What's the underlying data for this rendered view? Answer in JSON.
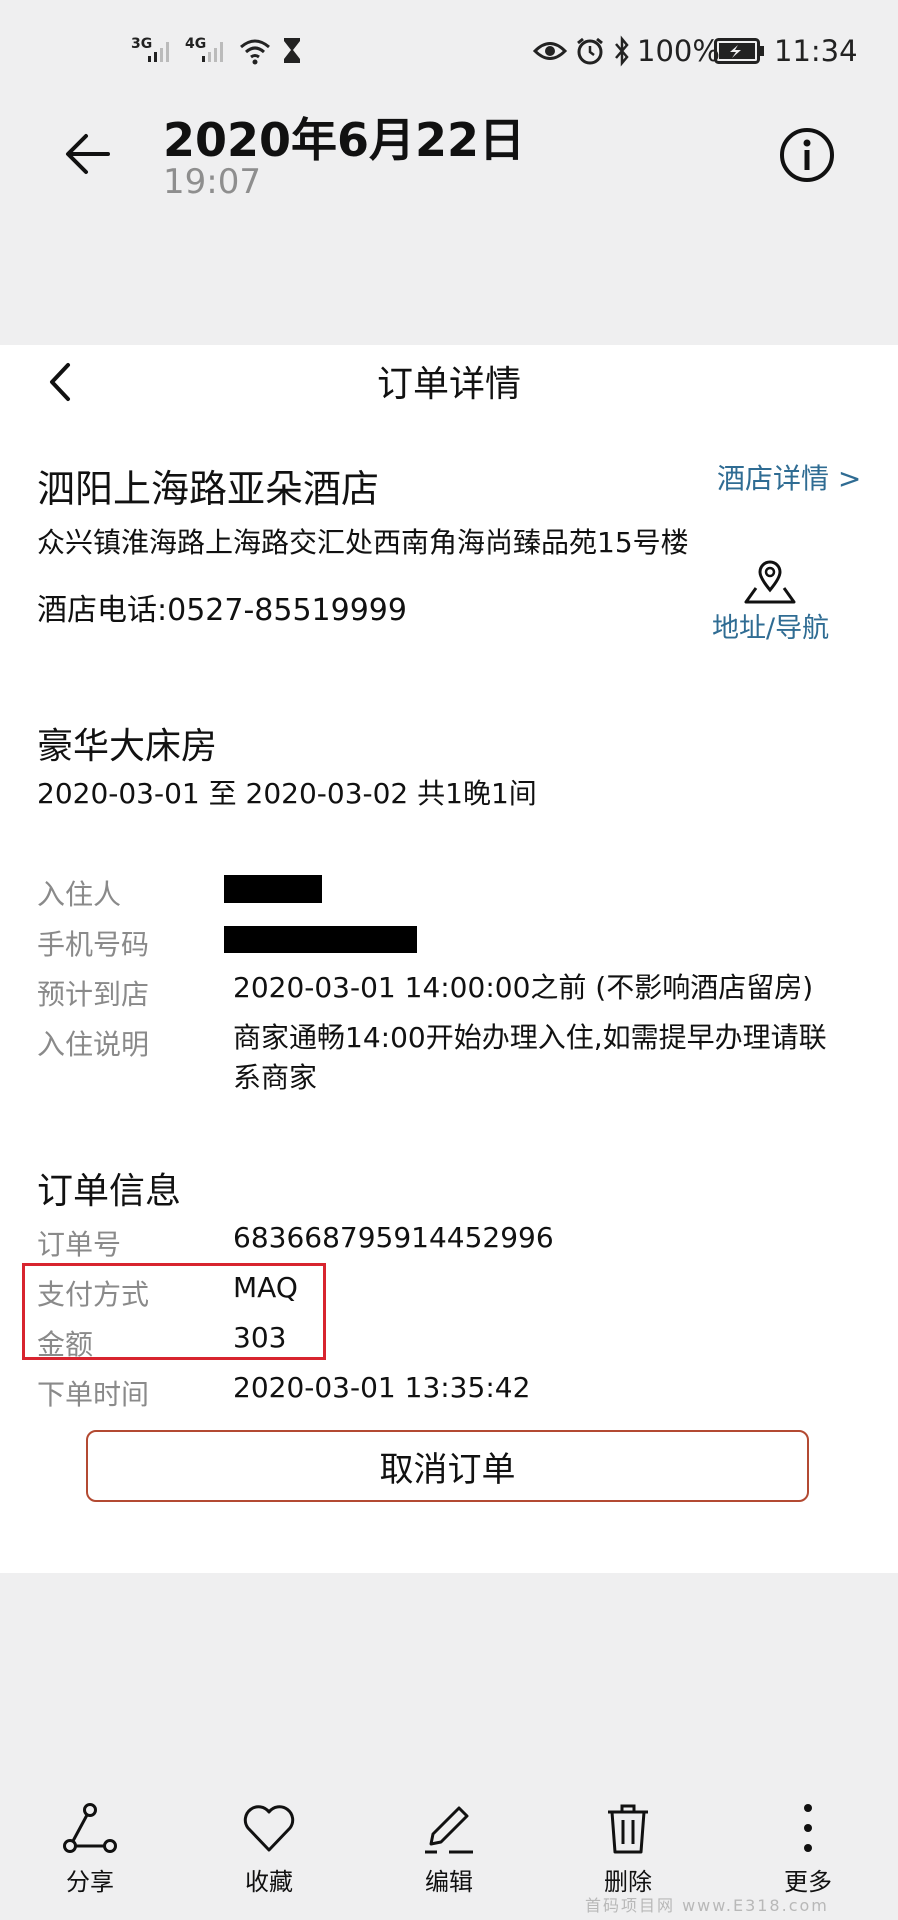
{
  "status_bar": {
    "net1": "3G",
    "net2": "4G",
    "battery": "100%",
    "time": "11:34"
  },
  "gallery_header": {
    "date": "2020年6月22日",
    "time": "19:07"
  },
  "order": {
    "page_title": "订单详情",
    "hotel_name": "泗阳上海路亚朵酒店",
    "hotel_detail_link": "酒店详情 >",
    "address": "众兴镇淮海路上海路交汇处西南角海尚臻品苑15号楼",
    "phone": "酒店电话:0527-85519999",
    "nav_label": "地址/导航",
    "room_type": "豪华大床房",
    "room_dates": "2020-03-01 至 2020-03-02 共1晚1间",
    "guest_label": "入住人",
    "mobile_label": "手机号码",
    "arrival_label": "预计到店",
    "arrival_value": "2020-03-01 14:00:00之前 (不影响酒店留房)",
    "checkin_label": "入住说明",
    "checkin_line1": "商家通畅14:00开始办理入住,如需提早办理请联",
    "checkin_line2": "系商家",
    "info_title": "订单信息",
    "order_no_label": "订单号",
    "order_no": "683668795914452996",
    "pay_label": "支付方式",
    "pay_value": "MAQ",
    "amount_label": "金额",
    "amount_value": "303",
    "order_time_label": "下单时间",
    "order_time": "2020-03-01 13:35:42",
    "cancel_button": "取消订单"
  },
  "bottom_bar": {
    "share": "分享",
    "favorite": "收藏",
    "edit": "编辑",
    "delete": "删除",
    "more": "更多"
  },
  "watermark": "首码项目网 www.E318.com"
}
